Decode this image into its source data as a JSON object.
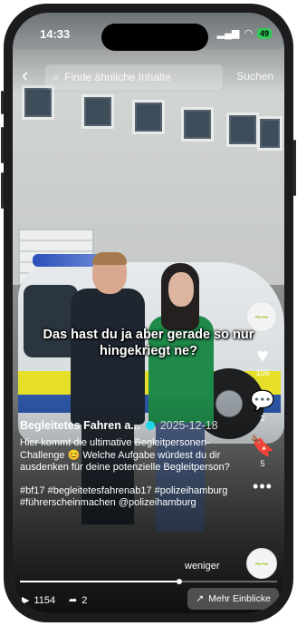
{
  "status_bar": {
    "time": "14:33",
    "signal": "signal",
    "wifi": "wifi",
    "battery": "49"
  },
  "search": {
    "placeholder": "Finde ähnliche Inhalte",
    "button": "Suchen"
  },
  "video_caption": "Das hast du ja aber gerade so nur hingekriegt ne?",
  "actions": {
    "brand_avatar_text": "~~",
    "likes": "105",
    "comments": "2",
    "saves": "5"
  },
  "post": {
    "author": "Begleitetes Fahren a...",
    "date": "2025-12-18",
    "text": "Hier kommt die ultimative Begleitpersonen-Challenge 😊 Welche Aufgabe würdest du dir ausdenken für deine potenzielle Begleitperson?",
    "hashtags": "#bf17 #begleitetesfahrenab17 #polizeihamburg #führerscheinmachen @polizeihamburg",
    "less_label": "weniger"
  },
  "progress": {
    "value": 0.62
  },
  "stats": {
    "plays": "1154",
    "shares": "2",
    "insights_label": "Mehr Einblicke"
  },
  "colors": {
    "verified": "#20d5ec",
    "battery": "#34c759",
    "brand": "#a6c42a"
  }
}
